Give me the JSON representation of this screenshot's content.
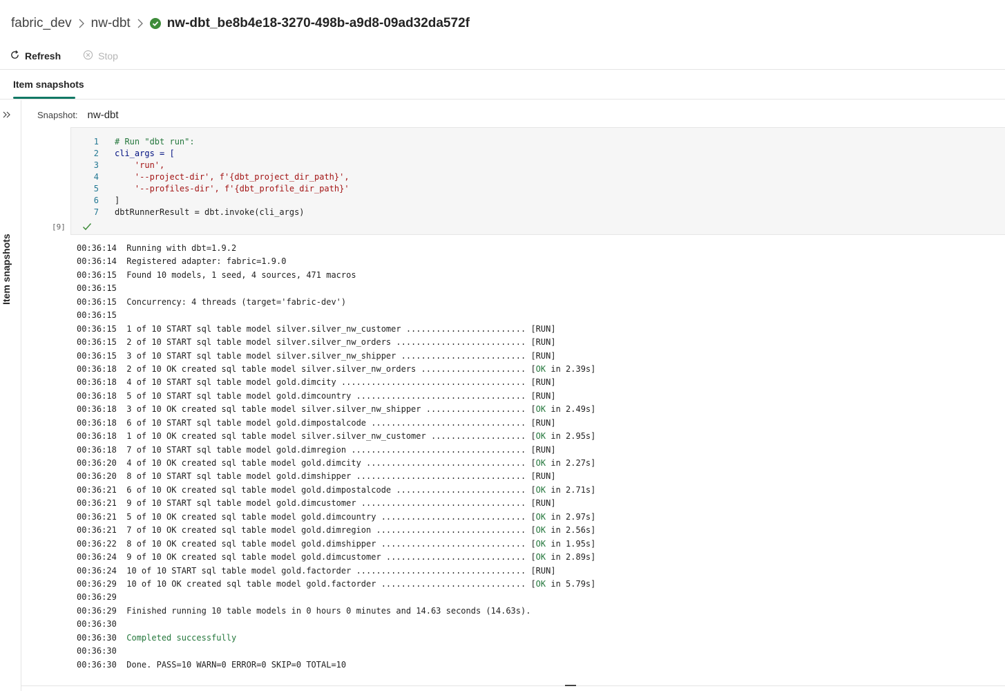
{
  "breadcrumb": {
    "workspace": "fabric_dev",
    "item": "nw-dbt",
    "run": "nw-dbt_be8b4e18-3270-498b-a9d8-09ad32da572f"
  },
  "toolbar": {
    "refresh_label": "Refresh",
    "stop_label": "Stop"
  },
  "tabs": [
    {
      "label": "Item snapshots",
      "active": true
    }
  ],
  "sidebar": {
    "label": "Item snapshots"
  },
  "snapshot": {
    "label": "Snapshot:",
    "value": "nw-dbt"
  },
  "cell": {
    "execution_count": "[9]",
    "status": "success",
    "lines": [
      {
        "n": "1",
        "text": "# Run \"dbt run\":"
      },
      {
        "n": "2",
        "text": "cli_args = ["
      },
      {
        "n": "3",
        "text": "    'run',"
      },
      {
        "n": "4",
        "text": "    '--project-dir', f'{dbt_project_dir_path}',"
      },
      {
        "n": "5",
        "text": "    '--profiles-dir', f'{dbt_profile_dir_path}'"
      },
      {
        "n": "6",
        "text": "]"
      },
      {
        "n": "7",
        "text": "dbtRunnerResult = dbt.invoke(cli_args)"
      }
    ]
  },
  "output": [
    {
      "time": "00:36:14",
      "msg": "Running with dbt=1.9.2"
    },
    {
      "time": "00:36:14",
      "msg": "Registered adapter: fabric=1.9.0"
    },
    {
      "time": "00:36:15",
      "msg": "Found 10 models, 1 seed, 4 sources, 471 macros"
    },
    {
      "time": "00:36:15",
      "msg": ""
    },
    {
      "time": "00:36:15",
      "msg": "Concurrency: 4 threads (target='fabric-dev')"
    },
    {
      "time": "00:36:15",
      "msg": ""
    },
    {
      "time": "00:36:15",
      "msg": "1 of 10 START sql table model silver.silver_nw_customer ........................ [RUN]"
    },
    {
      "time": "00:36:15",
      "msg": "2 of 10 START sql table model silver.silver_nw_orders .......................... [RUN]"
    },
    {
      "time": "00:36:15",
      "msg": "3 of 10 START sql table model silver.silver_nw_shipper ......................... [RUN]"
    },
    {
      "time": "00:36:18",
      "msg": "2 of 10 OK created sql table model silver.silver_nw_orders ..................... [",
      "ok": "OK",
      "tail": " in 2.39s]"
    },
    {
      "time": "00:36:18",
      "msg": "4 of 10 START sql table model gold.dimcity ..................................... [RUN]"
    },
    {
      "time": "00:36:18",
      "msg": "5 of 10 START sql table model gold.dimcountry .................................. [RUN]"
    },
    {
      "time": "00:36:18",
      "msg": "3 of 10 OK created sql table model silver.silver_nw_shipper .................... [",
      "ok": "OK",
      "tail": " in 2.49s]"
    },
    {
      "time": "00:36:18",
      "msg": "6 of 10 START sql table model gold.dimpostalcode ............................... [RUN]"
    },
    {
      "time": "00:36:18",
      "msg": "1 of 10 OK created sql table model silver.silver_nw_customer ................... [",
      "ok": "OK",
      "tail": " in 2.95s]"
    },
    {
      "time": "00:36:18",
      "msg": "7 of 10 START sql table model gold.dimregion ................................... [RUN]"
    },
    {
      "time": "00:36:20",
      "msg": "4 of 10 OK created sql table model gold.dimcity ................................ [",
      "ok": "OK",
      "tail": " in 2.27s]"
    },
    {
      "time": "00:36:20",
      "msg": "8 of 10 START sql table model gold.dimshipper .................................. [RUN]"
    },
    {
      "time": "00:36:21",
      "msg": "6 of 10 OK created sql table model gold.dimpostalcode .......................... [",
      "ok": "OK",
      "tail": " in 2.71s]"
    },
    {
      "time": "00:36:21",
      "msg": "9 of 10 START sql table model gold.dimcustomer ................................. [RUN]"
    },
    {
      "time": "00:36:21",
      "msg": "5 of 10 OK created sql table model gold.dimcountry ............................. [",
      "ok": "OK",
      "tail": " in 2.97s]"
    },
    {
      "time": "00:36:21",
      "msg": "7 of 10 OK created sql table model gold.dimregion .............................. [",
      "ok": "OK",
      "tail": " in 2.56s]"
    },
    {
      "time": "00:36:22",
      "msg": "8 of 10 OK created sql table model gold.dimshipper ............................. [",
      "ok": "OK",
      "tail": " in 1.95s]"
    },
    {
      "time": "00:36:24",
      "msg": "9 of 10 OK created sql table model gold.dimcustomer ............................ [",
      "ok": "OK",
      "tail": " in 2.89s]"
    },
    {
      "time": "00:36:24",
      "msg": "10 of 10 START sql table model gold.factorder .................................. [RUN]"
    },
    {
      "time": "00:36:29",
      "msg": "10 of 10 OK created sql table model gold.factorder ............................. [",
      "ok": "OK",
      "tail": " in 5.79s]"
    },
    {
      "time": "00:36:29",
      "msg": ""
    },
    {
      "time": "00:36:29",
      "msg": "Finished running 10 table models in 0 hours 0 minutes and 14.63 seconds (14.63s)."
    },
    {
      "time": "00:36:30",
      "msg": ""
    },
    {
      "time": "00:36:30",
      "msg": "",
      "success": "Completed successfully"
    },
    {
      "time": "00:36:30",
      "msg": ""
    },
    {
      "time": "00:36:30",
      "msg": "Done. PASS=10 WARN=0 ERROR=0 SKIP=0 TOTAL=10"
    }
  ],
  "colors": {
    "accent": "#117865",
    "success": "#3e8c3a",
    "ok_text": "#24773c"
  }
}
